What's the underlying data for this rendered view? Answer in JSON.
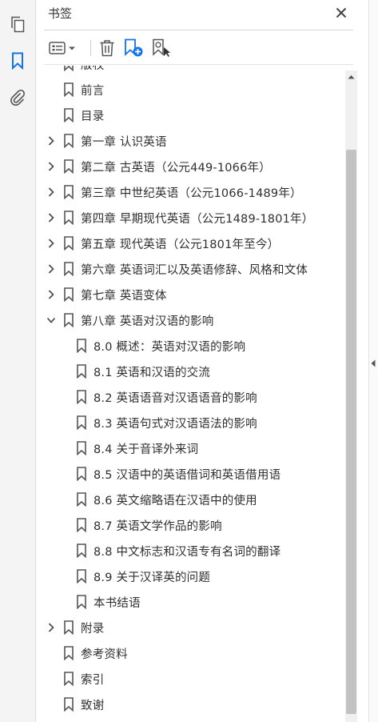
{
  "panel": {
    "title": "书签"
  },
  "rail": {
    "icons": [
      "pages-icon",
      "bookmarks-icon",
      "attachments-icon"
    ],
    "active_color": "#1473e6"
  },
  "toolbar": {
    "icons": [
      "options-menu-icon",
      "delete-bookmark-icon",
      "new-bookmark-icon",
      "bookmark-from-selection-icon"
    ]
  },
  "bookmarks": [
    {
      "label": "版权",
      "level": 0,
      "expander": "none"
    },
    {
      "label": "前言",
      "level": 0,
      "expander": "none"
    },
    {
      "label": "目录",
      "level": 0,
      "expander": "none"
    },
    {
      "label": "第一章  认识英语",
      "level": 0,
      "expander": "collapsed"
    },
    {
      "label": "第二章  古英语（公元449-1066年）",
      "level": 0,
      "expander": "collapsed"
    },
    {
      "label": "第三章  中世纪英语（公元1066-1489年）",
      "level": 0,
      "expander": "collapsed"
    },
    {
      "label": "第四章  早期现代英语（公元1489-1801年）",
      "level": 0,
      "expander": "collapsed"
    },
    {
      "label": "第五章  现代英语（公元1801年至今）",
      "level": 0,
      "expander": "collapsed"
    },
    {
      "label": "第六章  英语词汇以及英语修辞、风格和文体",
      "level": 0,
      "expander": "collapsed"
    },
    {
      "label": "第七章  英语变体",
      "level": 0,
      "expander": "collapsed"
    },
    {
      "label": "第八章  英语对汉语的影响",
      "level": 0,
      "expander": "expanded"
    },
    {
      "label": "8.0  概述：英语对汉语的影响",
      "level": 1,
      "expander": "none"
    },
    {
      "label": "8.1  英语和汉语的交流",
      "level": 1,
      "expander": "none"
    },
    {
      "label": "8.2  英语语音对汉语语音的影响",
      "level": 1,
      "expander": "none"
    },
    {
      "label": "8.3  英语句式对汉语语法的影响",
      "level": 1,
      "expander": "none"
    },
    {
      "label": "8.4  关于音译外来词",
      "level": 1,
      "expander": "none"
    },
    {
      "label": "8.5  汉语中的英语借词和英语借用语",
      "level": 1,
      "expander": "none"
    },
    {
      "label": "8.6  英文缩略语在汉语中的使用",
      "level": 1,
      "expander": "none"
    },
    {
      "label": "8.7  英语文学作品的影响",
      "level": 1,
      "expander": "none"
    },
    {
      "label": "8.8  中文标志和汉语专有名词的翻译",
      "level": 1,
      "expander": "none"
    },
    {
      "label": "8.9  关于汉译英的问题",
      "level": 1,
      "expander": "none"
    },
    {
      "label": "本书结语",
      "level": 1,
      "expander": "none"
    },
    {
      "label": "附录",
      "level": 0,
      "expander": "collapsed"
    },
    {
      "label": "参考资料",
      "level": 0,
      "expander": "none"
    },
    {
      "label": "索引",
      "level": 0,
      "expander": "none"
    },
    {
      "label": "致谢",
      "level": 0,
      "expander": "none"
    }
  ]
}
